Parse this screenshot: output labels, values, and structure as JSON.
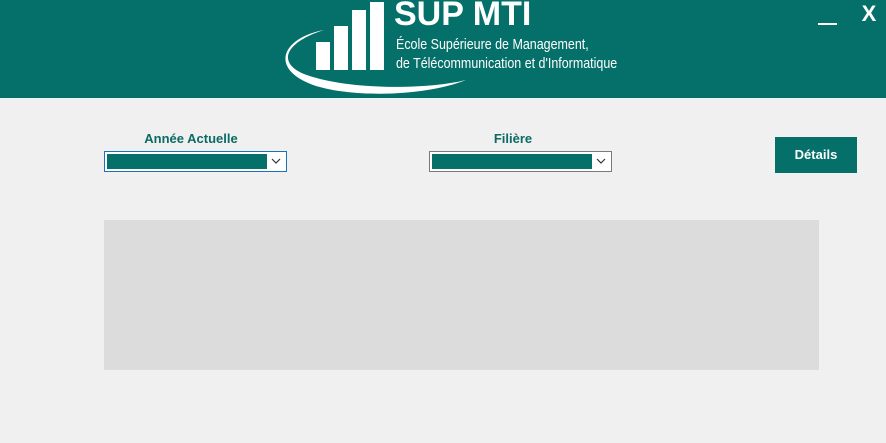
{
  "header": {
    "logo": {
      "title": "SUP MTI",
      "subtitle_line1": "École Supérieure de Management,",
      "subtitle_line2": "de Télécommunication et d'Informatique"
    },
    "minimize_label": "",
    "close_label": "X"
  },
  "form": {
    "annee": {
      "label": "Année Actuelle",
      "selected_value": ""
    },
    "filiere": {
      "label": "Filière",
      "selected_value": ""
    },
    "details_button": "Détails"
  },
  "colors": {
    "brand": "#047069",
    "label_text": "#0b6a64",
    "background": "#f0f0f0",
    "grid_background": "#dcdcdc"
  },
  "icons": [
    "logo-bars-icon",
    "logo-swoosh-icon",
    "minimize-icon",
    "close-icon",
    "chevron-down-icon"
  ]
}
